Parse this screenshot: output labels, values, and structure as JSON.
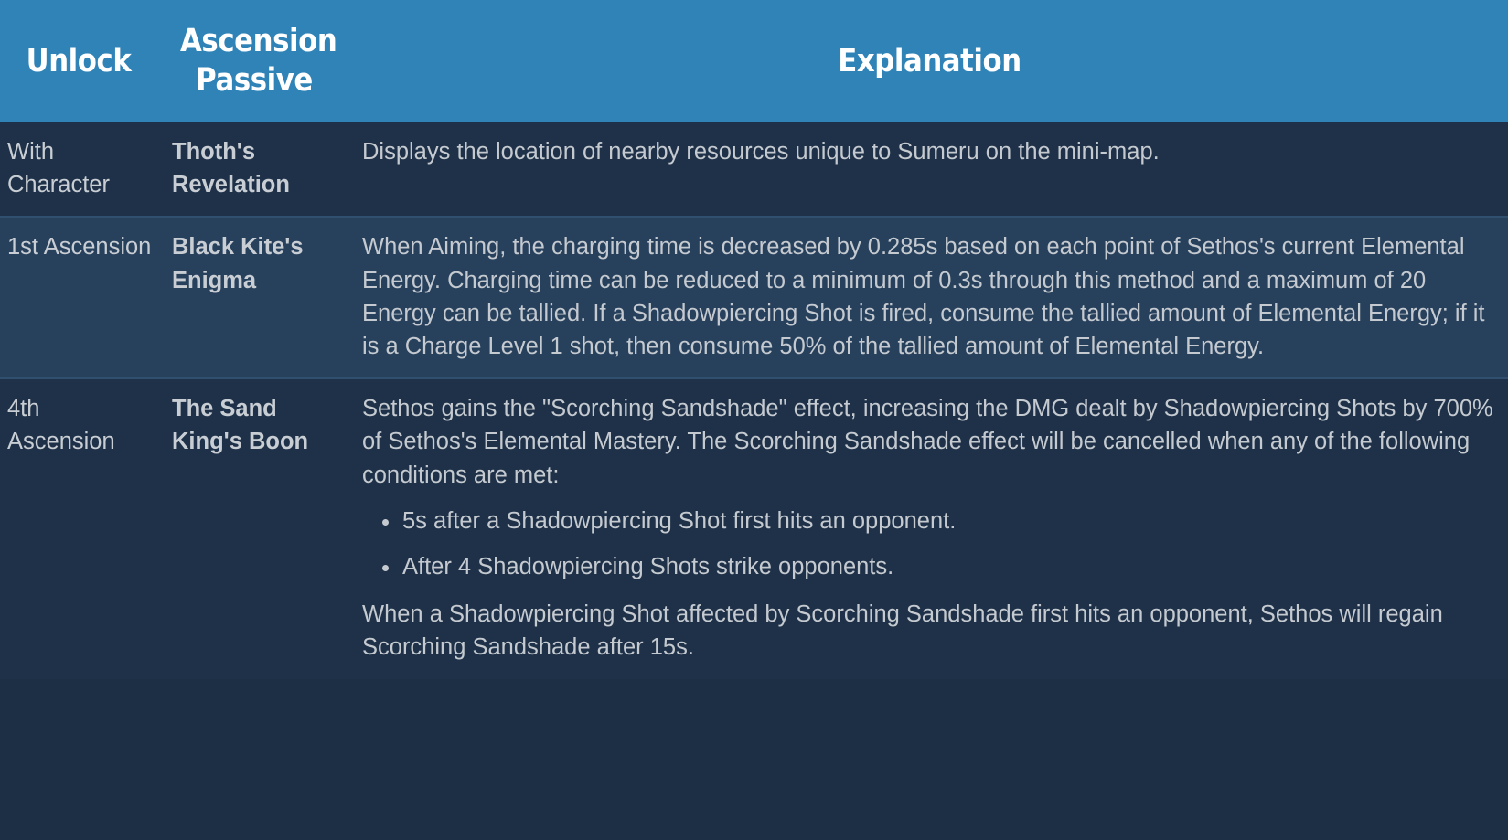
{
  "table": {
    "headers": {
      "unlock": "Unlock",
      "passive_line1": "Ascension",
      "passive_line2": "Passive",
      "explanation": "Explanation"
    },
    "colors": {
      "header_background": "#3083b7",
      "header_text": "#ffffff",
      "row_dark_background": "#1e3148",
      "row_light_background": "#27405c",
      "row_separator": "#31506f",
      "body_text": "#c8ccd1"
    },
    "rows": [
      {
        "unlock": "With Character",
        "passive": "Thoth's Revelation",
        "explanation": {
          "paragraph1": "Displays the location of nearby resources unique to Sumeru on the mini-map."
        }
      },
      {
        "unlock": "1st Ascension",
        "passive": "Black Kite's Enigma",
        "explanation": {
          "paragraph1": "When Aiming, the charging time is decreased by 0.285s based on each point of Sethos's current Elemental Energy. Charging time can be reduced to a minimum of 0.3s through this method and a maximum of 20 Energy can be tallied. If a Shadowpiercing Shot is fired, consume the tallied amount of Elemental Energy; if it is a Charge Level 1 shot, then consume 50% of the tallied amount of Elemental Energy."
        }
      },
      {
        "unlock": "4th Ascension",
        "passive": "The Sand King's Boon",
        "explanation": {
          "paragraph1": "Sethos gains the \"Scorching Sandshade\" effect, increasing the DMG dealt by Shadowpiercing Shots by 700% of Sethos's Elemental Mastery. The Scorching Sandshade effect will be cancelled when any of the following conditions are met:",
          "bullets": [
            "5s after a Shadowpiercing Shot first hits an opponent.",
            "After 4 Shadowpiercing Shots strike opponents."
          ],
          "paragraph2": "When a Shadowpiercing Shot affected by Scorching Sandshade first hits an opponent, Sethos will regain Scorching Sandshade after 15s."
        }
      }
    ]
  }
}
